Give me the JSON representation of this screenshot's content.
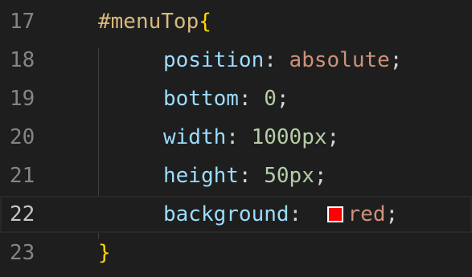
{
  "editor": {
    "lines": [
      {
        "number": "17",
        "selector": "#menuTop",
        "open_brace": "{"
      },
      {
        "number": "18",
        "property": "position",
        "colon": ":",
        "value": "absolute",
        "semicolon": ";"
      },
      {
        "number": "19",
        "property": "bottom",
        "colon": ":",
        "value": "0",
        "semicolon": ";"
      },
      {
        "number": "20",
        "property": "width",
        "colon": ":",
        "value": "1000",
        "unit": "px",
        "semicolon": ";"
      },
      {
        "number": "21",
        "property": "height",
        "colon": ":",
        "value": "50",
        "unit": "px",
        "semicolon": ";"
      },
      {
        "number": "22",
        "property": "background",
        "colon": ":",
        "value": "red",
        "semicolon": ";",
        "swatch_color": "#ff0000"
      },
      {
        "number": "23",
        "close_brace": "}"
      }
    ]
  },
  "colors": {
    "background": "#1e1e1e",
    "line_number": "#858585",
    "selector": "#d7ba7d",
    "brace": "#ffd700",
    "property": "#9cdcfe",
    "keyword_value": "#ce9178",
    "number_value": "#b5cea8"
  }
}
